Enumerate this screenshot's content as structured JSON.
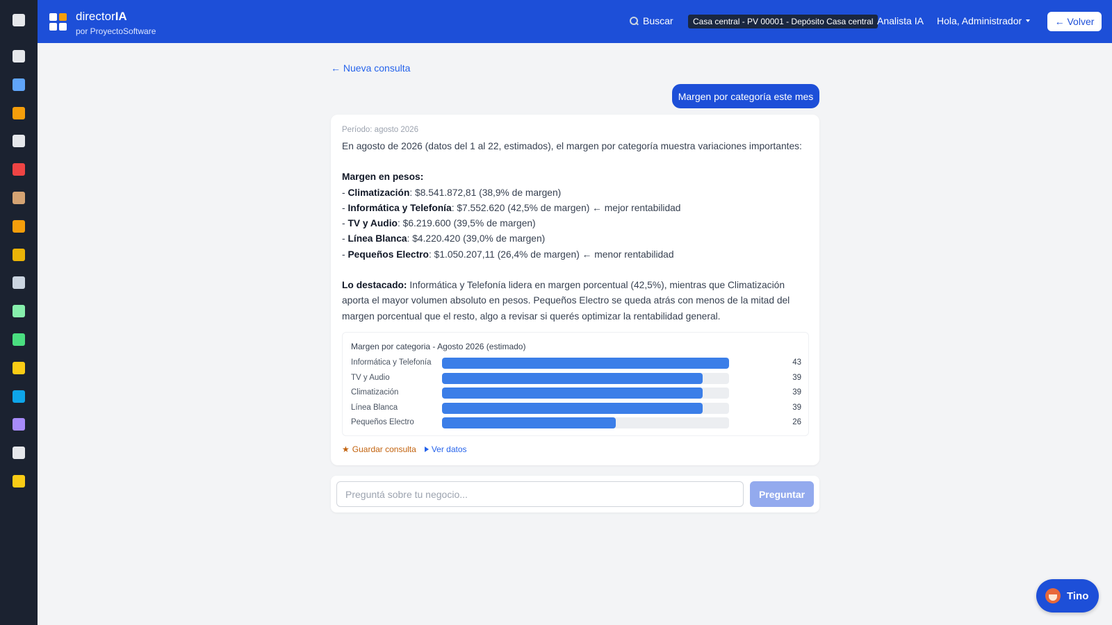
{
  "app": {
    "name_prefix": "director",
    "name_bold": "IA",
    "subtitle": "por ProyectoSoftware"
  },
  "topbar": {
    "search_label": "Buscar",
    "branch": "Casa central - PV 00001 - Depósito Casa central",
    "analyst_label": "Analista IA",
    "user_label": "Hola, Administrador",
    "back_button": "← Volver"
  },
  "sidebar": {
    "items": [
      {
        "icon": "home-icon",
        "color": "#e5e7eb"
      },
      {
        "icon": "bar-chart-icon",
        "color": "#60a5fa"
      },
      {
        "icon": "tag-icon",
        "color": "#f59e0b"
      },
      {
        "icon": "receipt-icon",
        "color": "#e5e7eb"
      },
      {
        "icon": "target-icon",
        "color": "#ef4444"
      },
      {
        "icon": "box-icon",
        "color": "#d4a373"
      },
      {
        "icon": "barcode-icon",
        "color": "#f59e0b"
      },
      {
        "icon": "money-bag-icon",
        "color": "#eab308"
      },
      {
        "icon": "cart-icon",
        "color": "#cbd5e1"
      },
      {
        "icon": "cash-icon",
        "color": "#86efac"
      },
      {
        "icon": "spreadsheet-icon",
        "color": "#4ade80"
      },
      {
        "icon": "note-icon",
        "color": "#facc15"
      },
      {
        "icon": "refresh-icon",
        "color": "#0ea5e9"
      },
      {
        "icon": "clapper-icon",
        "color": "#a78bfa"
      },
      {
        "icon": "gear-icon",
        "color": "#e5e7eb"
      },
      {
        "icon": "lock-icon",
        "color": "#facc15"
      }
    ]
  },
  "main": {
    "back_link": "← Nueva consulta",
    "user_question": "Margen por categoría este mes",
    "period": "Período: agosto 2026",
    "intro": "En agosto de 2026 (datos del 1 al 22, estimados), el margen por categoría muestra variaciones importantes:",
    "section_title": "Margen en pesos:",
    "items": [
      {
        "dash": "- ",
        "name": "Climatización",
        "detail": ": $8.541.872,81 (38,9% de margen)"
      },
      {
        "dash": "- ",
        "name": "Informática y Telefonía",
        "detail": ": $7.552.620 (42,5% de margen) ← mejor rentabilidad"
      },
      {
        "dash": "- ",
        "name": "TV y Audio",
        "detail": ": $6.219.600 (39,5% de margen)"
      },
      {
        "dash": "- ",
        "name": "Línea Blanca",
        "detail": ": $4.220.420 (39,0% de margen)"
      },
      {
        "dash": "- ",
        "name": "Pequeños Electro",
        "detail": ": $1.050.207,11 (26,4% de margen) ← menor rentabilidad"
      }
    ],
    "highlight_label": "Lo destacado:",
    "highlight_text": " Informática y Telefonía lidera en margen porcentual (42,5%), mientras que Climatización aporta el mayor volumen absoluto en pesos. Pequeños Electro se queda atrás con menos de la mitad del margen porcentual que el resto, algo a revisar si querés optimizar la rentabilidad general.",
    "save_label": "Guardar consulta",
    "view_data_label": "Ver datos",
    "ask_placeholder": "Preguntá sobre tu negocio...",
    "ask_button": "Preguntar"
  },
  "chart_data": {
    "type": "bar",
    "title": "Margen por categoria - Agosto 2026 (estimado)",
    "categories": [
      "Informática y Telefonía",
      "TV y Audio",
      "Climatización",
      "Línea Blanca",
      "Pequeños Electro"
    ],
    "values": [
      43,
      39,
      39,
      39,
      26
    ],
    "xlim": [
      0,
      43
    ],
    "color": "#3b7ee8"
  },
  "assistant": {
    "label": "Tino",
    "icon": "fox-icon"
  },
  "colors": {
    "brand": "#1d4fd8",
    "sidebar": "#1b2230",
    "link": "#2563eb",
    "save": "#c2620d"
  }
}
